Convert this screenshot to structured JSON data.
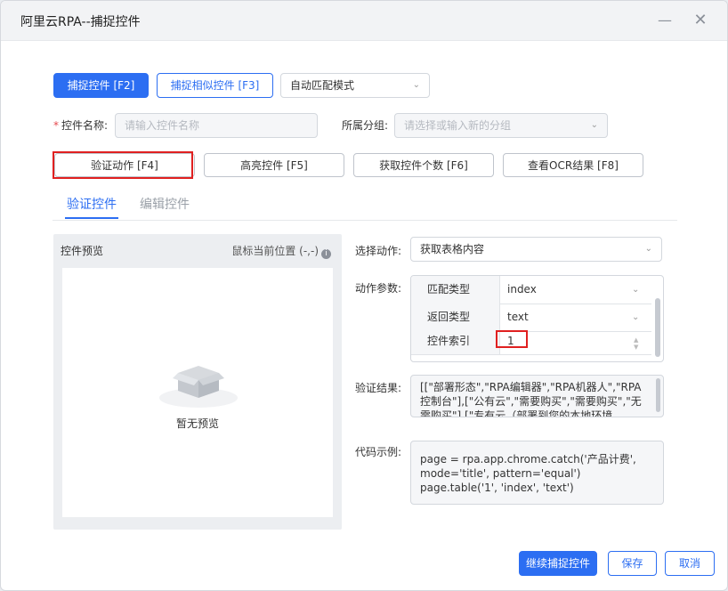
{
  "window": {
    "title": "阿里云RPA--捕捉控件",
    "minimize_icon": "minimize-icon",
    "close_icon": "close-icon"
  },
  "toolbar": {
    "capture_label": "捕捉控件 [F2]",
    "capture_similar_label": "捕捉相似控件 [F3]",
    "match_mode": {
      "value": "自动匹配模式",
      "icon": "chevron-down-icon"
    }
  },
  "form": {
    "name_label": "控件名称:",
    "name_required_mark": "*",
    "name_placeholder": "请输入控件名称",
    "group_label": "所属分组:",
    "group_placeholder": "请选择或输入新的分组"
  },
  "actions": {
    "verify_label": "验证动作 [F4]",
    "highlight_label": "高亮控件 [F5]",
    "count_label": "获取控件个数 [F6]",
    "ocr_label": "查看OCR结果 [F8]"
  },
  "tabs": [
    {
      "label": "验证控件",
      "active": true
    },
    {
      "label": "编辑控件",
      "active": false
    }
  ],
  "preview": {
    "title": "控件预览",
    "mouse_position": "鼠标当前位置 (-,-)",
    "info_icon": "info-icon",
    "empty_icon": "empty-box-icon",
    "empty_text": "暂无预览"
  },
  "action_select": {
    "label": "选择动作:",
    "value": "获取表格内容"
  },
  "params": {
    "label": "动作参数:",
    "rows": [
      {
        "key": "匹配类型",
        "value": "index"
      },
      {
        "key": "返回类型",
        "value": "text"
      },
      {
        "key": "控件索引",
        "value": "1"
      }
    ]
  },
  "result": {
    "label": "验证结果:",
    "text": "[[\"部署形态\",\"RPA编辑器\",\"RPA机器人\",\"RPA控制台\"],[\"公有云\",\"需要购买\",\"需要购买\",\"无需购买\"],[\"专有云（部署到您的本地环境"
  },
  "code": {
    "label": "代码示例:",
    "lines": [
      "page = rpa.app.chrome.catch('产品计费',",
      "mode='title', pattern='equal')",
      "page.table('1', 'index', 'text')"
    ]
  },
  "footer": {
    "continue_label": "继续捕捉控件",
    "save_label": "保存",
    "cancel_label": "取消"
  },
  "colors": {
    "primary": "#2c6ef2",
    "highlight_frame": "#e02020"
  }
}
